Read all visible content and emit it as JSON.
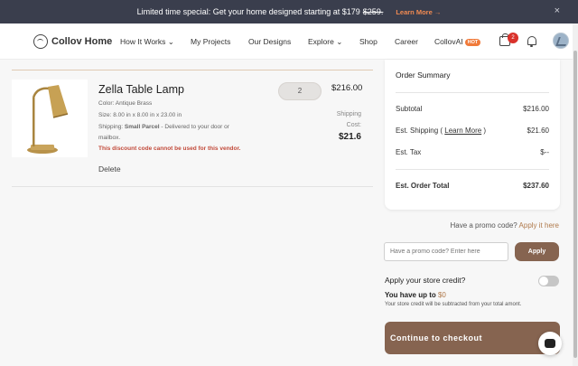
{
  "banner": {
    "text": "Limited time special: Get your home designed starting at $179",
    "old_price": "$259.",
    "link": "Learn More →",
    "close": "×"
  },
  "nav": {
    "logo": "Collov Home",
    "items": [
      "How It Works",
      "My Projects",
      "Our Designs",
      "Explore",
      "Shop",
      "Career",
      "CollovAI"
    ],
    "hot_badge": "HOT",
    "cart_count": "2"
  },
  "product": {
    "name": "Zella Table Lamp",
    "color": "Color: Antique Brass",
    "size": "Size: 8.00 in x 8.00 in x 23.00 in",
    "shipping_prefix": "Shipping:",
    "shipping_type": "Small Parcel",
    "shipping_suffix": "- Delivered to your door or",
    "shipping_line2": "mailbox.",
    "warning": "This discount code cannot be used for this vendor.",
    "delete": "Delete",
    "quantity": "2",
    "price": "$216.00",
    "shipping_label_1": "Shipping",
    "shipping_label_2": "Cost:",
    "shipping_cost": "$21.6"
  },
  "summary": {
    "title": "Order Summary",
    "subtotal_label": "Subtotal",
    "subtotal": "$216.00",
    "shipping_label": "Est. Shipping (",
    "shipping_learn": "Learn More",
    "shipping_close": ")",
    "shipping": "$21.60",
    "tax_label": "Est. Tax",
    "tax": "$--",
    "total_label": "Est. Order Total",
    "total": "$237.60"
  },
  "promo": {
    "question": "Have a promo code?",
    "apply_link": "Apply it here",
    "placeholder": "Have a promo code? Enter here",
    "apply_button": "Apply"
  },
  "credit": {
    "title": "Apply your store credit?",
    "available_prefix": "You have up to",
    "available_amount": "$0",
    "note": "Your store credit will be subtracted from your total amont."
  },
  "checkout": {
    "label": "Continue to checkout"
  },
  "colors": {
    "brand": "#866450",
    "banner_bg": "#3a3e4d",
    "accent_orange": "#f07a3a",
    "warning_red": "#c24a3a"
  }
}
